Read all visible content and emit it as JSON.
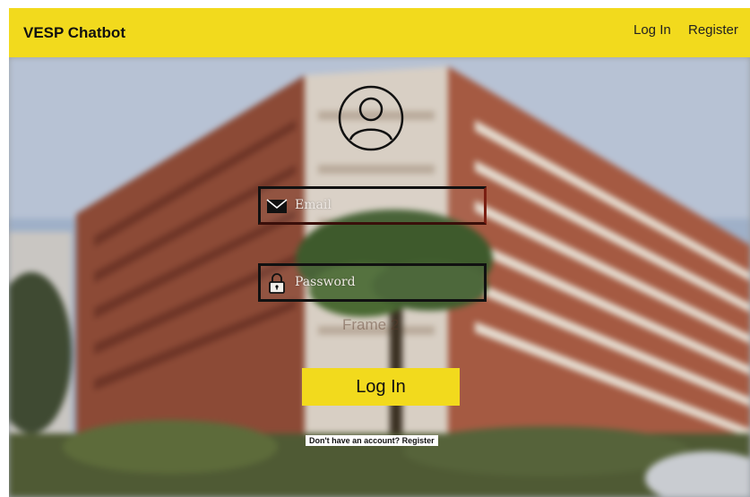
{
  "navbar": {
    "brand": "VESP Chatbot",
    "login_label": "Log In",
    "register_label": "Register",
    "color": "#f2da1d"
  },
  "background": {
    "icon": "campus-building-photo"
  },
  "avatar": {
    "icon": "user-avatar-icon"
  },
  "form": {
    "email": {
      "placeholder": "Email",
      "icon": "envelope-icon"
    },
    "password": {
      "placeholder": "Password",
      "icon": "lock-icon"
    },
    "ghost_text": "Frame 2",
    "submit_label": "Log In",
    "footer_prompt": "Don't have an account?",
    "footer_link": "Register"
  },
  "colors": {
    "accent": "#f2da1d",
    "text": "#111111"
  }
}
